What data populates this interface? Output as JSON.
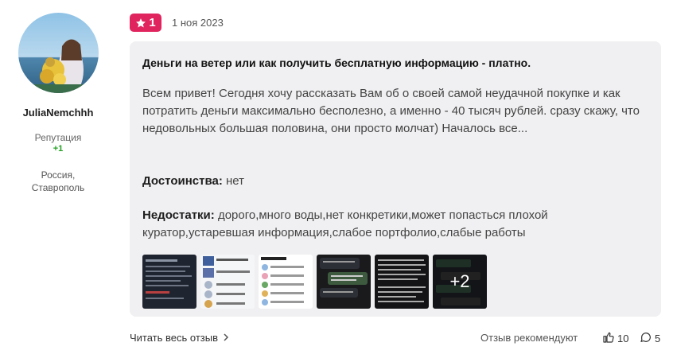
{
  "user": {
    "name": "JuliaNemchhh",
    "reputation_label": "Репутация",
    "reputation_value": "+1",
    "location_country": "Россия,",
    "location_city": "Ставрополь"
  },
  "review": {
    "rating": "1",
    "date": "1 ноя 2023",
    "title": "Деньги на ветер или как получить бесплатную информацию - платно.",
    "body": "Всем привет! Сегодня хочу рассказать Вам об о своей самой неудачной покупке и как потратить деньги максимально бесполезно, а именно - 40 тысяч рублей. сразу скажу, что недовольных большая половина, они просто молчат) Началось все...",
    "pros_label": "Достоинства:",
    "pros_value": "нет",
    "cons_label": "Недостатки:",
    "cons_value": "дорого,много воды,нет конкретики,может попасться плохой куратор,устаревшая информация,слабое портфолио,слабые работы",
    "more_photos": "+2"
  },
  "footer": {
    "read_more": "Читать весь отзыв",
    "recommend_label": "Отзыв рекомендуют",
    "likes_count": "10",
    "comments_count": "5"
  },
  "colors": {
    "badge": "#e0245e",
    "card_bg": "#f0f0f2",
    "reputation": "#22a022"
  }
}
